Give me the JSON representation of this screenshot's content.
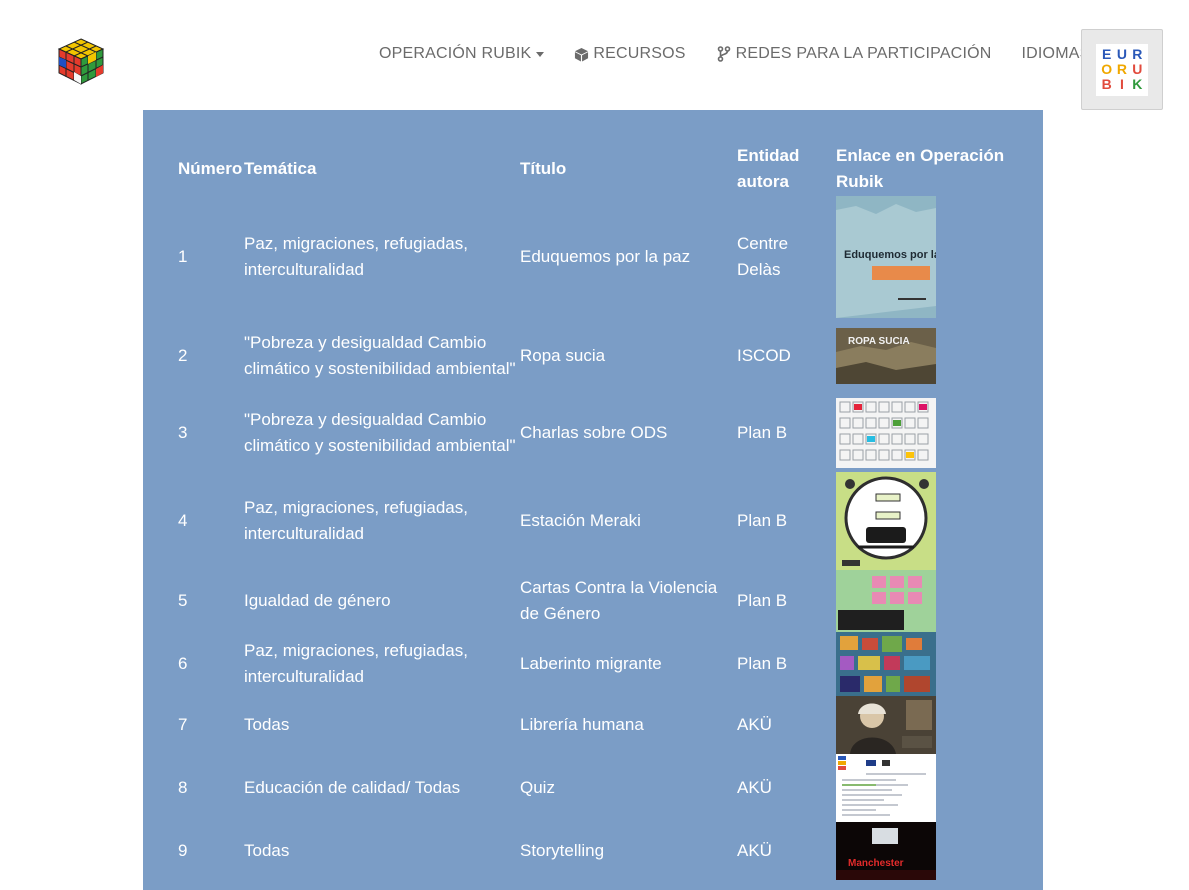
{
  "nav": {
    "items": [
      {
        "label": "OPERACIÓN RUBIK",
        "icon": "caret-down-icon"
      },
      {
        "label": "RECURSOS",
        "icon": "cube-icon"
      },
      {
        "label": "REDES PARA LA PARTICIPACIÓN",
        "icon": "code-branch-icon"
      },
      {
        "label": "IDIOMAS"
      }
    ]
  },
  "eurorubik_logo": {
    "letters": [
      "E",
      "U",
      "R",
      "O",
      "R",
      "U",
      "B",
      "I",
      "K"
    ]
  },
  "table": {
    "headers": {
      "numero": "Número",
      "tematica": "Temática",
      "titulo": "Título",
      "entidad": "Entidad autora",
      "enlace": "Enlace en Operación Rubik"
    },
    "rows": [
      {
        "numero": "1",
        "tematica": "Paz, migraciones, refugiadas, interculturalidad",
        "titulo": "Eduquemos por la paz",
        "entidad": "Centre Delàs",
        "thumb_text": "Eduquemos por la Paz:"
      },
      {
        "numero": "2",
        "tematica": "\"Pobreza y desigualdad Cambio climático y sostenibilidad ambiental\"",
        "titulo": "Ropa sucia",
        "entidad": "ISCOD",
        "thumb_text": "ROPA SUCIA"
      },
      {
        "numero": "3",
        "tematica": "\"Pobreza y desigualdad Cambio climático y sostenibilidad ambiental\"",
        "titulo": "Charlas sobre ODS",
        "entidad": "Plan B",
        "thumb_text": ""
      },
      {
        "numero": "4",
        "tematica": "Paz, migraciones, refugiadas, interculturalidad",
        "titulo": "Estación Meraki",
        "entidad": "Plan B",
        "thumb_text": ""
      },
      {
        "numero": "5",
        "tematica": "Igualdad de género",
        "titulo": "Cartas Contra la Violencia de Género",
        "entidad": "Plan B",
        "thumb_text": ""
      },
      {
        "numero": "6",
        "tematica": "Paz, migraciones, refugiadas, interculturalidad",
        "titulo": "Laberinto migrante",
        "entidad": "Plan B",
        "thumb_text": ""
      },
      {
        "numero": "7",
        "tematica": "Todas",
        "titulo": "Librería humana",
        "entidad": "AKÜ",
        "thumb_text": ""
      },
      {
        "numero": "8",
        "tematica": "Educación de calidad/ Todas",
        "titulo": "Quiz",
        "entidad": "AKÜ",
        "thumb_text": ""
      },
      {
        "numero": "9",
        "tematica": "Todas",
        "titulo": "Storytelling",
        "entidad": "AKÜ",
        "thumb_text": "Manchester"
      }
    ]
  }
}
